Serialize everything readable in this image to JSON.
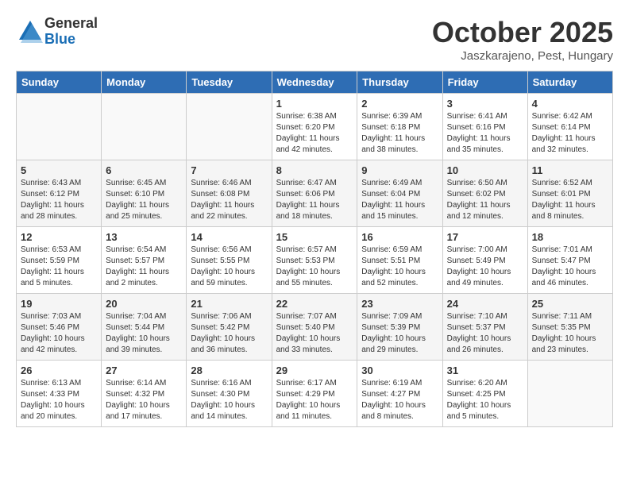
{
  "header": {
    "logo": {
      "general": "General",
      "blue": "Blue"
    },
    "title": "October 2025",
    "subtitle": "Jaszkarajeno, Pest, Hungary"
  },
  "weekdays": [
    "Sunday",
    "Monday",
    "Tuesday",
    "Wednesday",
    "Thursday",
    "Friday",
    "Saturday"
  ],
  "weeks": [
    [
      {
        "day": "",
        "info": ""
      },
      {
        "day": "",
        "info": ""
      },
      {
        "day": "",
        "info": ""
      },
      {
        "day": "1",
        "info": "Sunrise: 6:38 AM\nSunset: 6:20 PM\nDaylight: 11 hours\nand 42 minutes."
      },
      {
        "day": "2",
        "info": "Sunrise: 6:39 AM\nSunset: 6:18 PM\nDaylight: 11 hours\nand 38 minutes."
      },
      {
        "day": "3",
        "info": "Sunrise: 6:41 AM\nSunset: 6:16 PM\nDaylight: 11 hours\nand 35 minutes."
      },
      {
        "day": "4",
        "info": "Sunrise: 6:42 AM\nSunset: 6:14 PM\nDaylight: 11 hours\nand 32 minutes."
      }
    ],
    [
      {
        "day": "5",
        "info": "Sunrise: 6:43 AM\nSunset: 6:12 PM\nDaylight: 11 hours\nand 28 minutes."
      },
      {
        "day": "6",
        "info": "Sunrise: 6:45 AM\nSunset: 6:10 PM\nDaylight: 11 hours\nand 25 minutes."
      },
      {
        "day": "7",
        "info": "Sunrise: 6:46 AM\nSunset: 6:08 PM\nDaylight: 11 hours\nand 22 minutes."
      },
      {
        "day": "8",
        "info": "Sunrise: 6:47 AM\nSunset: 6:06 PM\nDaylight: 11 hours\nand 18 minutes."
      },
      {
        "day": "9",
        "info": "Sunrise: 6:49 AM\nSunset: 6:04 PM\nDaylight: 11 hours\nand 15 minutes."
      },
      {
        "day": "10",
        "info": "Sunrise: 6:50 AM\nSunset: 6:02 PM\nDaylight: 11 hours\nand 12 minutes."
      },
      {
        "day": "11",
        "info": "Sunrise: 6:52 AM\nSunset: 6:01 PM\nDaylight: 11 hours\nand 8 minutes."
      }
    ],
    [
      {
        "day": "12",
        "info": "Sunrise: 6:53 AM\nSunset: 5:59 PM\nDaylight: 11 hours\nand 5 minutes."
      },
      {
        "day": "13",
        "info": "Sunrise: 6:54 AM\nSunset: 5:57 PM\nDaylight: 11 hours\nand 2 minutes."
      },
      {
        "day": "14",
        "info": "Sunrise: 6:56 AM\nSunset: 5:55 PM\nDaylight: 10 hours\nand 59 minutes."
      },
      {
        "day": "15",
        "info": "Sunrise: 6:57 AM\nSunset: 5:53 PM\nDaylight: 10 hours\nand 55 minutes."
      },
      {
        "day": "16",
        "info": "Sunrise: 6:59 AM\nSunset: 5:51 PM\nDaylight: 10 hours\nand 52 minutes."
      },
      {
        "day": "17",
        "info": "Sunrise: 7:00 AM\nSunset: 5:49 PM\nDaylight: 10 hours\nand 49 minutes."
      },
      {
        "day": "18",
        "info": "Sunrise: 7:01 AM\nSunset: 5:47 PM\nDaylight: 10 hours\nand 46 minutes."
      }
    ],
    [
      {
        "day": "19",
        "info": "Sunrise: 7:03 AM\nSunset: 5:46 PM\nDaylight: 10 hours\nand 42 minutes."
      },
      {
        "day": "20",
        "info": "Sunrise: 7:04 AM\nSunset: 5:44 PM\nDaylight: 10 hours\nand 39 minutes."
      },
      {
        "day": "21",
        "info": "Sunrise: 7:06 AM\nSunset: 5:42 PM\nDaylight: 10 hours\nand 36 minutes."
      },
      {
        "day": "22",
        "info": "Sunrise: 7:07 AM\nSunset: 5:40 PM\nDaylight: 10 hours\nand 33 minutes."
      },
      {
        "day": "23",
        "info": "Sunrise: 7:09 AM\nSunset: 5:39 PM\nDaylight: 10 hours\nand 29 minutes."
      },
      {
        "day": "24",
        "info": "Sunrise: 7:10 AM\nSunset: 5:37 PM\nDaylight: 10 hours\nand 26 minutes."
      },
      {
        "day": "25",
        "info": "Sunrise: 7:11 AM\nSunset: 5:35 PM\nDaylight: 10 hours\nand 23 minutes."
      }
    ],
    [
      {
        "day": "26",
        "info": "Sunrise: 6:13 AM\nSunset: 4:33 PM\nDaylight: 10 hours\nand 20 minutes."
      },
      {
        "day": "27",
        "info": "Sunrise: 6:14 AM\nSunset: 4:32 PM\nDaylight: 10 hours\nand 17 minutes."
      },
      {
        "day": "28",
        "info": "Sunrise: 6:16 AM\nSunset: 4:30 PM\nDaylight: 10 hours\nand 14 minutes."
      },
      {
        "day": "29",
        "info": "Sunrise: 6:17 AM\nSunset: 4:29 PM\nDaylight: 10 hours\nand 11 minutes."
      },
      {
        "day": "30",
        "info": "Sunrise: 6:19 AM\nSunset: 4:27 PM\nDaylight: 10 hours\nand 8 minutes."
      },
      {
        "day": "31",
        "info": "Sunrise: 6:20 AM\nSunset: 4:25 PM\nDaylight: 10 hours\nand 5 minutes."
      },
      {
        "day": "",
        "info": ""
      }
    ]
  ]
}
